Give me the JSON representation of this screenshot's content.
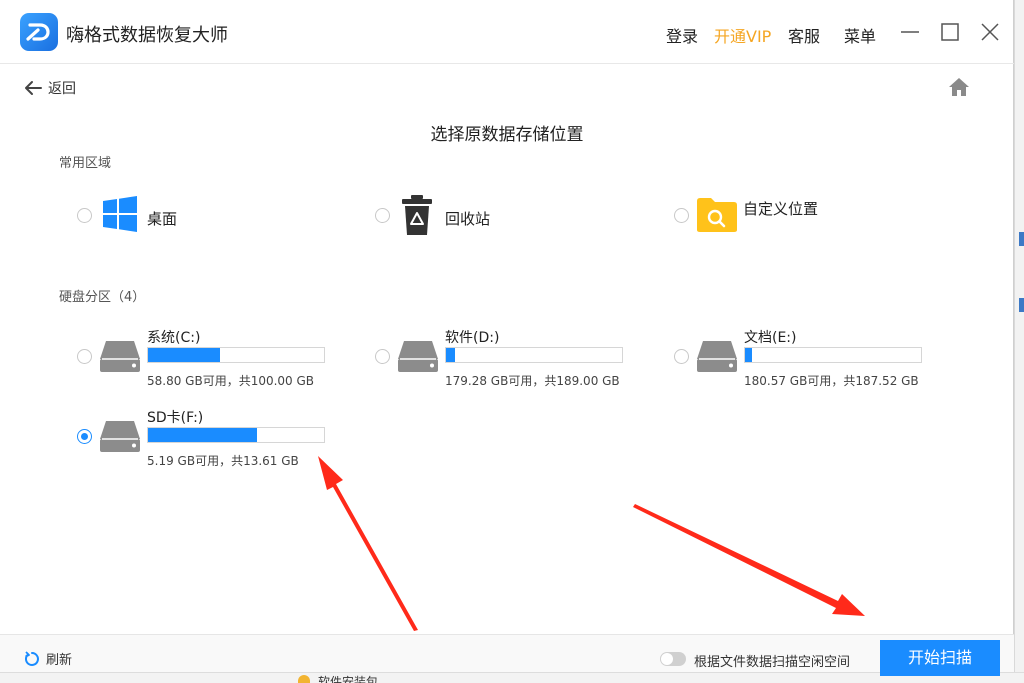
{
  "app": {
    "title": "嗨格式数据恢复大师"
  },
  "titlebar": {
    "login": "登录",
    "vip": "开通VIP",
    "service": "客服",
    "menu": "菜单"
  },
  "nav": {
    "back": "返回"
  },
  "main": {
    "title": "选择原数据存储位置"
  },
  "common": {
    "label": "常用区域",
    "items": [
      {
        "label": "桌面",
        "icon": "windows-icon",
        "checked": false
      },
      {
        "label": "回收站",
        "icon": "recycle-bin-icon",
        "checked": false
      },
      {
        "label": "自定义位置",
        "icon": "folder-search-icon",
        "checked": false
      }
    ]
  },
  "disks": {
    "label": "硬盘分区（4）",
    "items": [
      {
        "name": "系统(C:)",
        "size": "58.80 GB可用，共100.00 GB",
        "used_fraction": 0.41,
        "checked": false
      },
      {
        "name": "软件(D:)",
        "size": "179.28 GB可用，共189.00 GB",
        "used_fraction": 0.05,
        "checked": false
      },
      {
        "name": "文档(E:)",
        "size": "180.57 GB可用，共187.52 GB",
        "used_fraction": 0.04,
        "checked": false
      },
      {
        "name": "SD卡(F:)",
        "size": "5.19 GB可用，共13.61 GB",
        "used_fraction": 0.62,
        "checked": true
      }
    ]
  },
  "bottom": {
    "refresh": "刷新",
    "toggle_label": "根据文件数据扫描空闲空间",
    "toggle_on": false,
    "scan_button": "开始扫描"
  },
  "desktop": {
    "taskbar_text": "软件安装包"
  },
  "colors": {
    "accent": "#1a8cff",
    "vip": "#f5a623",
    "annotation_arrow": "#ff2a1a"
  }
}
